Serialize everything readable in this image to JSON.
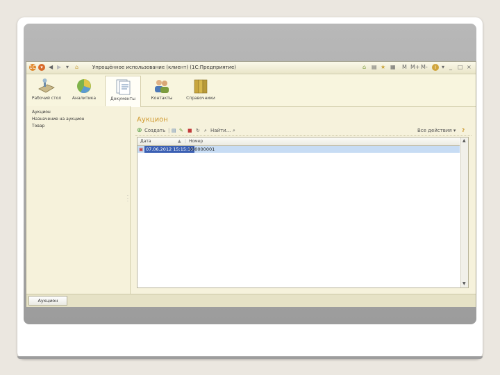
{
  "window": {
    "title": "Упрощённое использование (клиент) (1С:Предприятие)",
    "controls": [
      "M",
      "M+",
      "M-",
      "i",
      "_",
      "□",
      "×"
    ]
  },
  "ribbon": {
    "items": [
      {
        "label": "Рабочий стол",
        "icon": "desk-icon"
      },
      {
        "label": "Аналитика",
        "icon": "pie-chart-icon"
      },
      {
        "label": "Документы",
        "icon": "documents-icon"
      },
      {
        "label": "Контакты",
        "icon": "contacts-icon"
      },
      {
        "label": "Справочники",
        "icon": "folders-icon"
      }
    ],
    "active_index": 2
  },
  "nav": {
    "items": [
      "Аукцион",
      "Назначение на аукцион",
      "Товар"
    ]
  },
  "content": {
    "title": "Аукцион",
    "toolbar": {
      "add_label": "Создать",
      "find_label": "Найти...",
      "actions_label": "Все действия ▾",
      "help_label": "?"
    },
    "table": {
      "columns": [
        "Дата",
        "Номер"
      ],
      "rows": [
        {
          "date": "07.06.2012 15:15:10",
          "number": "000000001"
        }
      ]
    }
  },
  "status": {
    "task_button": "Аукцион"
  },
  "colors": {
    "accent": "#d09a2f",
    "selected_row": "#c7dcf4",
    "selected_cell": "#3a5fb3"
  }
}
